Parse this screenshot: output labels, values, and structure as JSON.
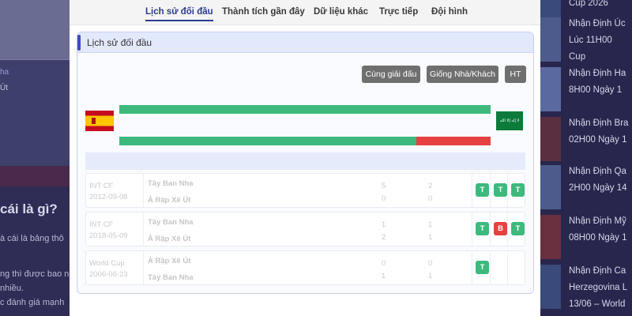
{
  "background": {
    "left_nav_a": "ha",
    "left_nav_b": "Út",
    "heading": "cái là gì?",
    "lines": [
      "à cái là bảng thô",
      "ng thì được bao n",
      "nhiều.",
      "c đánh giá mạnh"
    ]
  },
  "sidebar_right": {
    "items": [
      {
        "lines": [
          "Cup 2026"
        ]
      },
      {
        "lines": [
          "Nhận Định Úc",
          "Lúc 11H00",
          "Cup"
        ]
      },
      {
        "lines": [
          "Nhận Định Ha",
          "8H00 Ngày 1"
        ]
      },
      {
        "lines": [
          "Nhận Định Bra",
          "02H00 Ngày 1"
        ]
      },
      {
        "lines": [
          "Nhận Định Qa",
          "2H00 Ngày 14"
        ]
      },
      {
        "lines": [
          "Nhận Định Mỹ",
          "08H00 Ngày 1"
        ]
      },
      {
        "lines": [
          "Nhận Định Ca",
          "Herzegovina L",
          "13/06 – World"
        ]
      }
    ]
  },
  "tabs": [
    "Lịch sử đối đầu",
    "Thành tích gần đây",
    "Dữ liệu khác",
    "Trực tiếp",
    "Đội hình"
  ],
  "panel": {
    "title": "Lịch sử đối đầu",
    "buttons": {
      "same_league": "Cùng giải đấu",
      "home_away": "Giống Nhà/Khách",
      "ht": "HT"
    }
  },
  "teams": {
    "home": "Tây Ban Nha",
    "away": "Ả Rập Xê Út"
  },
  "flags": {
    "saudi_text": "لا إله إلا الله"
  },
  "summary": {
    "bar1_green_pct": 100,
    "bar2_green_pct": 80,
    "bar2_red_pct": 20,
    "colors": {
      "win": "#3db97d",
      "loss": "#e64141"
    }
  },
  "table": {
    "matches": [
      {
        "league": "INT CF",
        "date": "2012-09-08",
        "team1": "Tây Ban Nha",
        "team2": "Ả Rập Xê Út",
        "score1": "5",
        "score2": "0",
        "ht1": "2",
        "ht2": "0",
        "results": [
          "T",
          "T",
          "T"
        ]
      },
      {
        "league": "INT CF",
        "date": "2018-05-09",
        "team1": "Tây Ban Nha",
        "team2": "Ả Rập Xê Út",
        "score1": "1",
        "score2": "2",
        "ht1": "1",
        "ht2": "1",
        "results": [
          "T",
          "B",
          "T"
        ]
      },
      {
        "league": "World Cup",
        "date": "2006-06-23",
        "team1": "Ả Rập Xê Út",
        "team2": "Tây Ban Nha",
        "score1": "0",
        "score2": "1",
        "ht1": "0",
        "ht2": "1",
        "results": [
          "T"
        ]
      }
    ]
  }
}
